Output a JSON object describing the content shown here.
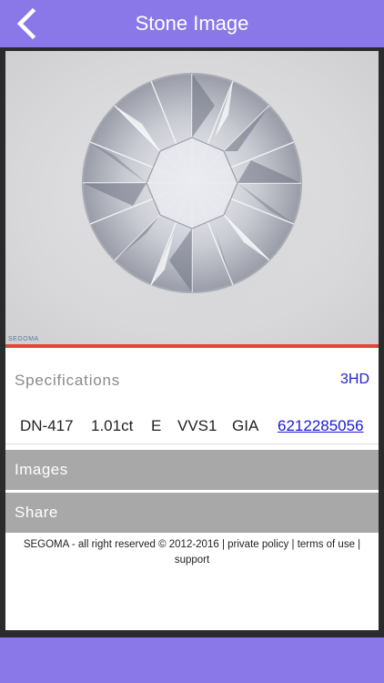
{
  "header": {
    "title": "Stone Image",
    "color": "#8b78e8"
  },
  "image": {
    "watermark": "SEGOMA"
  },
  "specifications": {
    "title": "Specifications",
    "view_3d": "3HD",
    "id": "DN-417",
    "carat": "1.01ct",
    "color": "E",
    "clarity": "VVS1",
    "lab": "GIA",
    "certificate": "6212285056"
  },
  "sections": {
    "images": "Images",
    "share": "Share"
  },
  "footer": {
    "copyright": "SEGOMA - all right reserved © 2012-2016",
    "sep1": "|",
    "privacy": "private policy",
    "sep2": "|",
    "terms": "terms of use",
    "sep3": "|",
    "support": "support"
  },
  "icons": {
    "back": "chevron-left-icon"
  }
}
